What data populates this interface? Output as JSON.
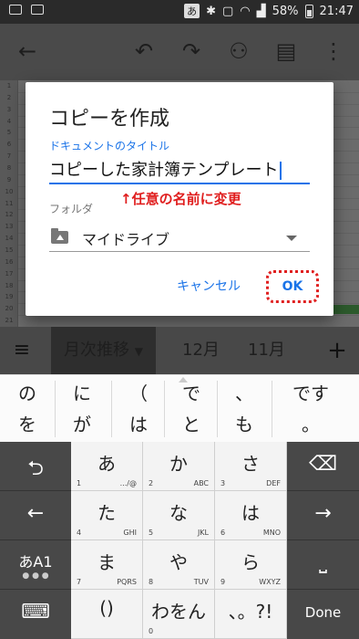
{
  "status_bar": {
    "ime": "あ",
    "battery": "58%",
    "time": "21:47"
  },
  "toolbar": {
    "back_icon": "arrow-left",
    "undo_icon": "undo",
    "redo_icon": "redo",
    "add_person_icon": "person-add",
    "comment_icon": "comment",
    "more_icon": "more-vert"
  },
  "sheet": {
    "row_numbers": [
      "1",
      "2",
      "3",
      "4",
      "5",
      "6",
      "7",
      "8",
      "9",
      "10",
      "11",
      "12",
      "13",
      "14",
      "15",
      "16",
      "17",
      "18",
      "19",
      "20",
      "21"
    ]
  },
  "dialog": {
    "title": "コピーを作成",
    "doc_title_label": "ドキュメントのタイトル",
    "doc_title_value": "コピーした家計簿テンプレート",
    "annotation": "↑任意の名前に変更",
    "folder_label": "フォルダ",
    "folder_value": "マイドライブ",
    "cancel_label": "キャンセル",
    "ok_label": "OK"
  },
  "sheet_tabs": {
    "active": "月次推移",
    "tabs": [
      "12月",
      "11月"
    ]
  },
  "suggestions": {
    "top": [
      "の",
      "に",
      "（",
      "で",
      "、",
      "です"
    ],
    "bottom": [
      "を",
      "が",
      "は",
      "と",
      "も",
      "。"
    ]
  },
  "keyboard": {
    "keys": [
      {
        "main": "あ",
        "num": "1",
        "sym": "☆"
      },
      {
        "main": "か",
        "num": "2",
        "sym": "ABC"
      },
      {
        "main": "さ",
        "num": "3",
        "sym": "DEF"
      },
      {
        "main": "た",
        "num": "4",
        "sym": "GHI"
      },
      {
        "main": "な",
        "num": "5",
        "sym": "JKL"
      },
      {
        "main": "は",
        "num": "6",
        "sym": "MNO"
      },
      {
        "main": "ま",
        "num": "7",
        "sym": "PQRS"
      },
      {
        "main": "や",
        "num": "8",
        "sym": "TUV"
      },
      {
        "main": "ら",
        "num": "9",
        "sym": "WXYZ"
      },
      {
        "main": "()",
        "num": "",
        "sym": ""
      },
      {
        "main": "わをん",
        "num": "0",
        "sym": ""
      },
      {
        "main": "、。?!",
        "num": "",
        "sym": ""
      }
    ],
    "mode_label": "あA1",
    "done_label": "Done"
  }
}
